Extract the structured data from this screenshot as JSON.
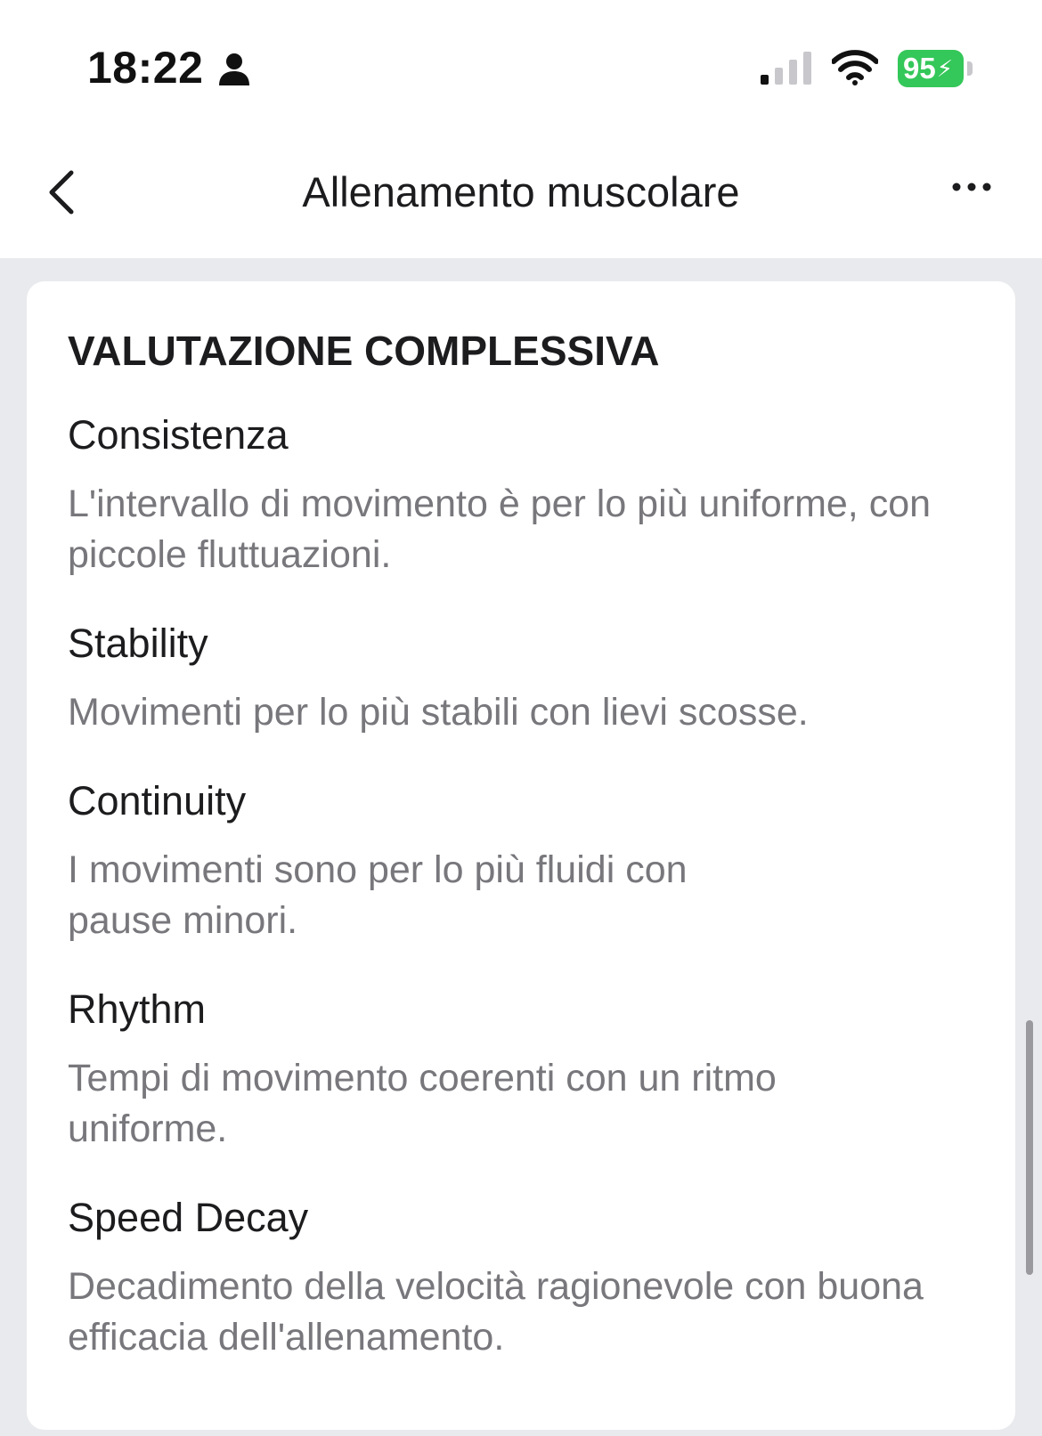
{
  "status_bar": {
    "time": "18:22",
    "battery_level": "95",
    "battery_color": "#34c759",
    "icons": [
      "person-icon",
      "cellular-signal-icon",
      "wifi-icon",
      "battery-charging-icon"
    ]
  },
  "nav": {
    "title": "Allenamento muscolare",
    "back_icon": "chevron-left-icon",
    "more_icon": "ellipsis-icon"
  },
  "section": {
    "heading": "VALUTAZIONE COMPLESSIVA",
    "items": [
      {
        "title": "Consistenza",
        "description": "L'intervallo di movimento è per lo più uniforme, con piccole fluttuazioni."
      },
      {
        "title": "Stability",
        "description": "Movimenti per lo più stabili con lievi scosse."
      },
      {
        "title": "Continuity",
        "description": "I movimenti sono per lo più fluidi con pause minori."
      },
      {
        "title": "Rhythm",
        "description": "Tempi di movimento coerenti con un ritmo uniforme."
      },
      {
        "title": "Speed Decay",
        "description": "Decadimento della velocità ragionevole con buona efficacia dell'allenamento."
      }
    ]
  }
}
